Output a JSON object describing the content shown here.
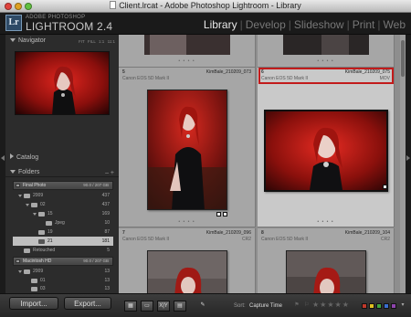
{
  "window": {
    "title": "Client.lrcat - Adobe Photoshop Lightroom - Library"
  },
  "identity": {
    "line1": "ADOBE PHOTOSHOP",
    "line2": "LIGHTROOM 2.4",
    "logo": "Lr"
  },
  "modules": [
    "Library",
    "Develop",
    "Slideshow",
    "Print",
    "Web"
  ],
  "active_module": "Library",
  "navigator": {
    "title": "Navigator",
    "zoom_options": [
      "FIT",
      "FILL",
      "1:1",
      "11:1"
    ]
  },
  "catalog": {
    "title": "Catalog"
  },
  "folders": {
    "title": "Folders",
    "volumes": [
      {
        "name": "Final Photo",
        "info": "90.0 / 207 GB"
      },
      {
        "name": "Macintosh HD",
        "info": "90.0 / 207 GB"
      }
    ],
    "rows": [
      {
        "name": "2009",
        "count": "437"
      },
      {
        "name": "02",
        "count": "437"
      },
      {
        "name": "15",
        "count": "169"
      },
      {
        "name": "Jpeg",
        "count": "10"
      },
      {
        "name": "19",
        "count": "87"
      },
      {
        "name": "21",
        "count": "181"
      },
      {
        "name": "Retouched",
        "count": "5"
      },
      {
        "name": "2009",
        "count": "13"
      },
      {
        "name": "01",
        "count": "13"
      },
      {
        "name": "03",
        "count": "13"
      }
    ]
  },
  "buttons": {
    "import": "Import...",
    "export": "Export..."
  },
  "grid": {
    "cells": [
      {
        "num": "5",
        "file": "KimBale_210209_073",
        "camera": "Canon EOS 5D Mark II",
        "ext": ""
      },
      {
        "num": "6",
        "file": "KimBale_210209_075",
        "camera": "Canon EOS 5D Mark II",
        "ext": "MOV"
      },
      {
        "num": "7",
        "file": "KimBale_210209_096",
        "camera": "Canon EOS 5D Mark II",
        "ext": "CR2"
      },
      {
        "num": "8",
        "file": "KimBale_210209_104",
        "camera": "Canon EOS 5D Mark II",
        "ext": "CR2"
      }
    ]
  },
  "toolbar": {
    "sort_label": "Sort:",
    "sort_value": "Capture Time"
  },
  "colors": {
    "accent_selected": "#c21b1b",
    "label_colors": [
      "#c0392b",
      "#e0c020",
      "#3fa53f",
      "#3a6ed0",
      "#8e44ad"
    ]
  }
}
